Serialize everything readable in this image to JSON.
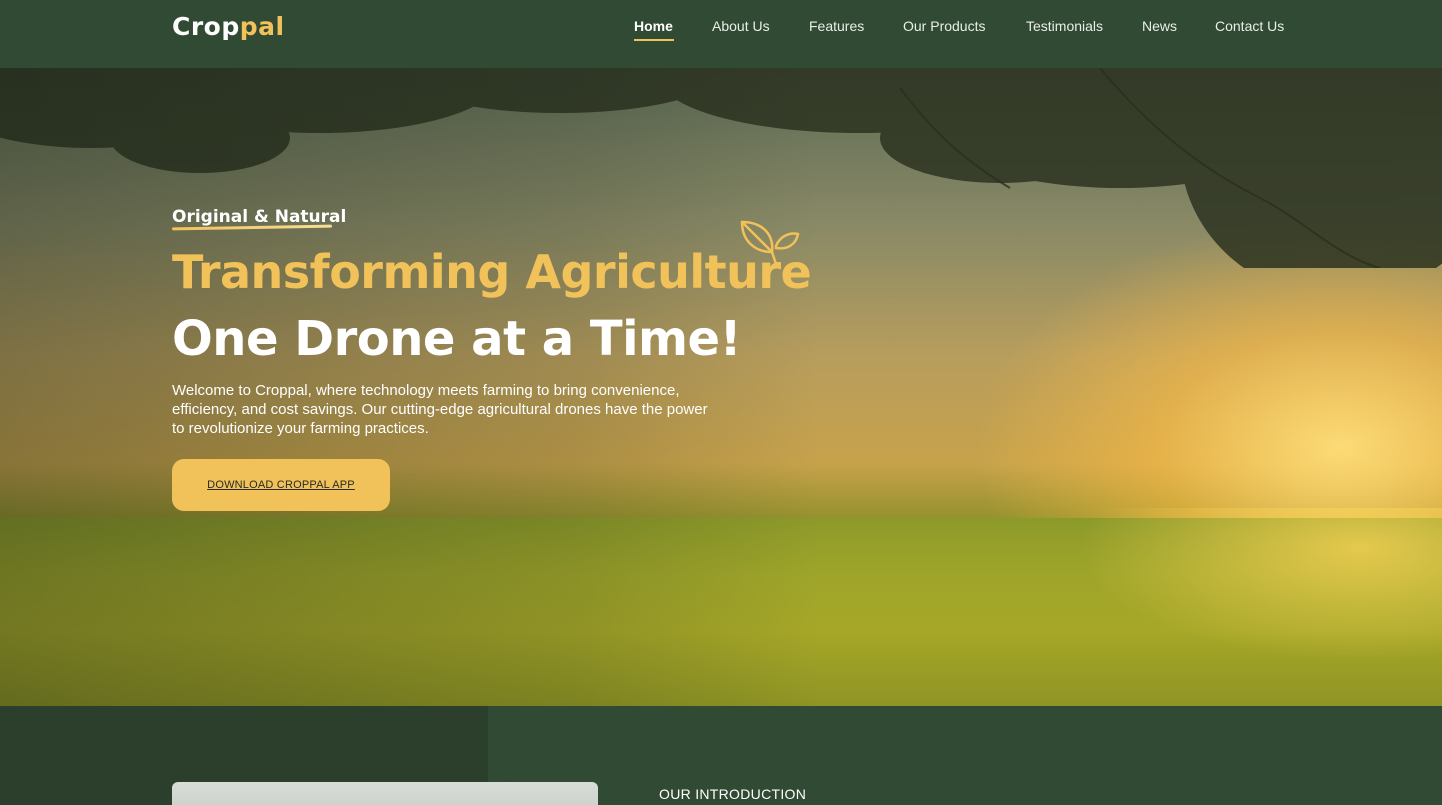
{
  "brand": {
    "part1": "Crop",
    "part2": "pal"
  },
  "nav": {
    "items": [
      {
        "label": "Home"
      },
      {
        "label": "About Us"
      },
      {
        "label": "Features"
      },
      {
        "label": "Our Products"
      },
      {
        "label": "Testimonials"
      },
      {
        "label": "News"
      },
      {
        "label": "Contact Us"
      }
    ]
  },
  "hero": {
    "eyebrow": "Original & Natural",
    "headline_line1": "Transforming Agriculture",
    "headline_line2": "One Drone at a Time!",
    "description": "Welcome to Croppal, where technology meets farming to bring convenience, efficiency, and cost savings. Our cutting-edge agricultural drones have the power to revolutionize your farming practices.",
    "cta_label": "DOWNLOAD CROPPAL APP",
    "decor_icon": "leaf-icon"
  },
  "intro": {
    "label": "OUR INTRODUCTION"
  },
  "colors": {
    "accent": "#f2c25a",
    "header_bg": "#314a34",
    "dark_green": "#2b3f2c"
  }
}
